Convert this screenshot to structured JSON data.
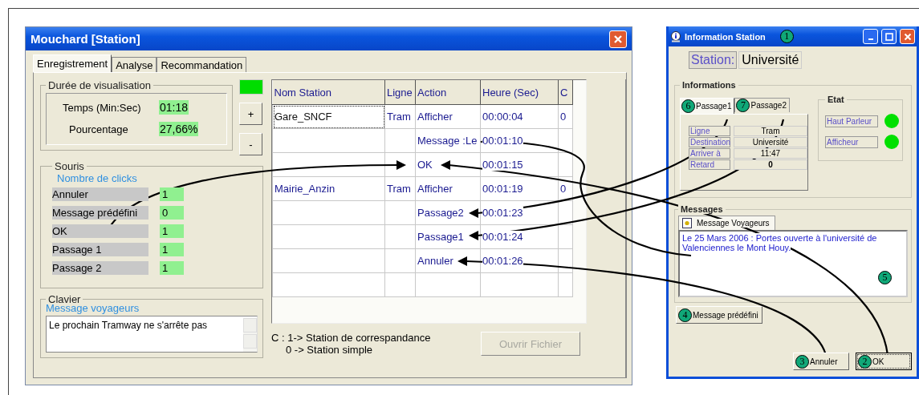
{
  "main_window": {
    "title": "Mouchard [Station]",
    "tabs": [
      {
        "label": "Enregistrement",
        "selected": true
      },
      {
        "label": "Analyse",
        "selected": false
      },
      {
        "label": "Recommandation",
        "selected": false
      }
    ],
    "duration": {
      "legend": "Durée de visualisation",
      "rows": [
        {
          "label": "Temps (Min:Sec)",
          "value": "01:18"
        },
        {
          "label": "Pourcentage",
          "value": "27,66%"
        }
      ]
    },
    "zoom_buttons": [
      "+",
      "-"
    ],
    "mouse": {
      "legend": "Souris",
      "subtitle": "Nombre de clicks",
      "rows": [
        {
          "label": "Annuler",
          "count": "1"
        },
        {
          "label": "Message prédéfini",
          "count": "0"
        },
        {
          "label": "OK",
          "count": "1"
        },
        {
          "label": "Passage 1",
          "count": "1"
        },
        {
          "label": "Passage 2",
          "count": "1"
        }
      ]
    },
    "keyboard": {
      "legend": "Clavier",
      "subtitle": "Message voyageurs",
      "value": "Le prochain Tramway ne s'arrête pas"
    },
    "table": {
      "columns": [
        "Nom Station",
        "Ligne",
        "Action",
        "Heure (Sec)",
        "C"
      ],
      "rows": [
        {
          "station": "Gare_SNCF",
          "line": "Tram",
          "action": "Afficher",
          "time": "00:00:04",
          "c": "0",
          "focused": true
        },
        {
          "action": "Message :Le",
          "time": "00:01:10",
          "focused": false
        },
        {
          "action": "OK",
          "time": "00:01:15",
          "focused": false
        },
        {
          "station": "Mairie_Anzin",
          "line": "Tram",
          "action": "Afficher",
          "time": "00:01:19",
          "c": "0",
          "focused": false
        },
        {
          "action": "Passage2",
          "time": "00:01:23",
          "focused": false
        },
        {
          "action": "Passage1",
          "time": "00:01:24",
          "focused": false
        },
        {
          "action": "Annuler",
          "time": "00:01:26",
          "focused": false
        }
      ]
    },
    "legend_lines": [
      "C : 1-> Station de correspandance",
      "0 -> Station simple"
    ],
    "open_button": {
      "label": "Ouvrir Fichier",
      "disabled": true
    }
  },
  "info_window": {
    "title": "Information Station",
    "badge": "1",
    "station_label": "Station:",
    "station_value": "Université",
    "informations": {
      "legend": "Informations",
      "tabs": [
        {
          "label": "Passage1",
          "badge": "6",
          "selected": true
        },
        {
          "label": "Passage2",
          "badge": "7",
          "selected": false
        }
      ],
      "fields": [
        {
          "label": "Ligne",
          "value": "Tram",
          "emphasis": false
        },
        {
          "label": "Destination",
          "value": "Université",
          "emphasis": false
        },
        {
          "label": "Arriver à",
          "value": "11:47",
          "emphasis": false
        },
        {
          "label": "Retard",
          "value": "0",
          "emphasis": true
        }
      ]
    },
    "etat": {
      "legend": "Etat",
      "items": [
        {
          "label": "Haut Parleur",
          "color": "#00e000"
        },
        {
          "label": "Afficheur",
          "color": "#00e000"
        }
      ]
    },
    "messages": {
      "legend": "Messages",
      "tab": "Message Voyageurs",
      "text": "Le 25 Mars 2006 : Portes ouverte à l'université de Valenciennes le Mont Houy.",
      "badge": "5",
      "predefined_button": {
        "label": "Message prédéfini",
        "badge": "4"
      }
    },
    "buttons": [
      {
        "label": "Annuler",
        "badge": "3",
        "default": false
      },
      {
        "label": "OK",
        "badge": "2",
        "default": true
      }
    ]
  }
}
